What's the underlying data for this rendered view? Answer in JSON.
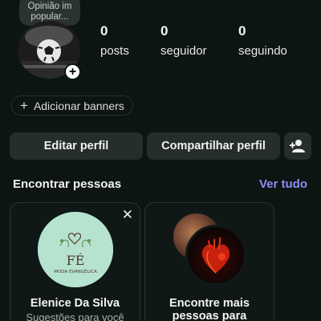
{
  "profile": {
    "note": "Opinião im popular...",
    "stats": [
      {
        "value": "0",
        "label": "posts"
      },
      {
        "value": "0",
        "label": "seguidor"
      },
      {
        "value": "0",
        "label": "seguindo"
      }
    ]
  },
  "banners": {
    "label": "Adicionar banners"
  },
  "actions": {
    "edit": "Editar perfil",
    "share": "Compartilhar perfil"
  },
  "discover": {
    "title": "Encontrar pessoas",
    "see_all": "Ver tudo",
    "cards": [
      {
        "name": "Elenice Da Silva",
        "subtitle": "Sugestões para você",
        "logo_title": "FÉ",
        "logo_tagline": "MODA EVANGÉLICA"
      },
      {
        "name": "Encontre mais pessoas para se..."
      }
    ]
  },
  "colors": {
    "background": "#0d1513",
    "button": "#262e2d",
    "accent_link": "#8a8df7",
    "logo_bg": "#b6e3cf"
  },
  "icons": {
    "add_note": "plus-icon",
    "add_banner": "plus-icon",
    "discover_people": "add-person-icon",
    "dismiss": "close-icon"
  }
}
